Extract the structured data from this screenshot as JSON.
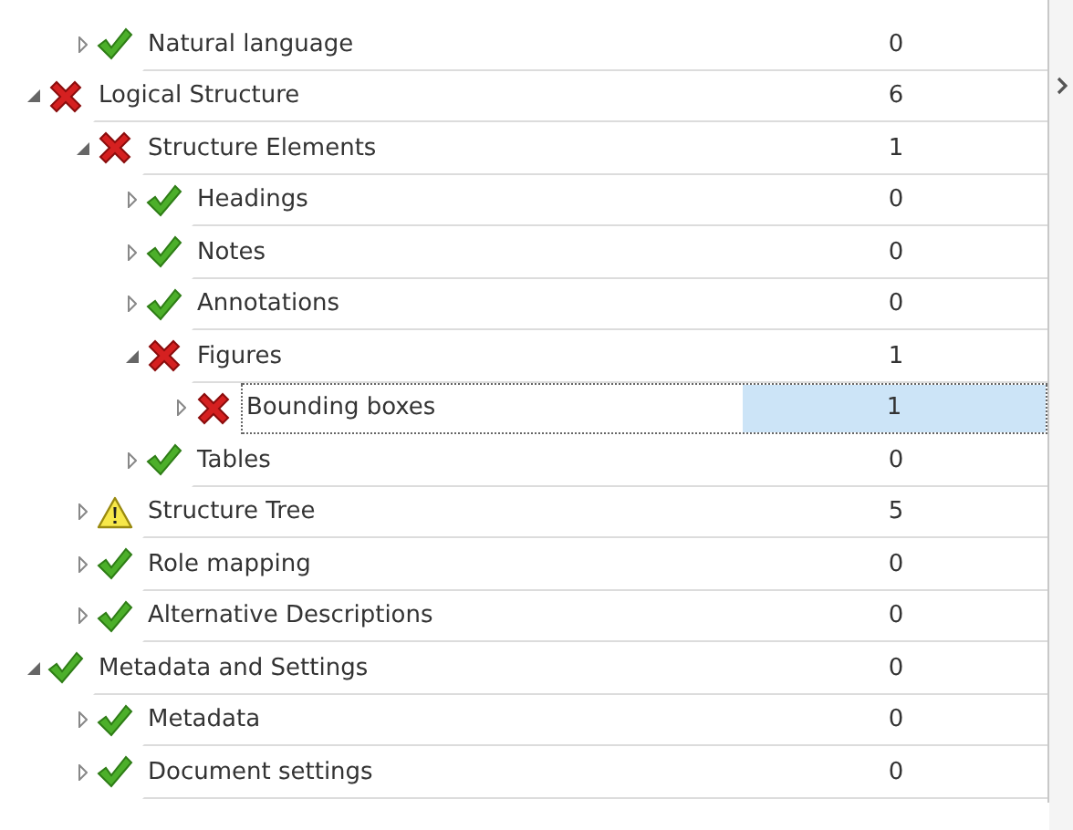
{
  "tree": {
    "continued": [
      {
        "label": "Natural language",
        "count": "0",
        "kind": "pass",
        "expanded": false,
        "selected": false
      }
    ],
    "items": [
      {
        "label": "Logical Structure",
        "count": "6",
        "kind": "fail",
        "expanded": true,
        "selected": false,
        "children": [
          {
            "label": "Structure Elements",
            "count": "1",
            "kind": "fail",
            "expanded": true,
            "selected": false,
            "children": [
              {
                "label": "Headings",
                "count": "0",
                "kind": "pass",
                "expanded": false,
                "selected": false
              },
              {
                "label": "Notes",
                "count": "0",
                "kind": "pass",
                "expanded": false,
                "selected": false
              },
              {
                "label": "Annotations",
                "count": "0",
                "kind": "pass",
                "expanded": false,
                "selected": false
              },
              {
                "label": "Figures",
                "count": "1",
                "kind": "fail",
                "expanded": true,
                "selected": false,
                "children": [
                  {
                    "label": "Bounding boxes",
                    "count": "1",
                    "kind": "fail",
                    "expanded": false,
                    "selected": true
                  }
                ]
              },
              {
                "label": "Tables",
                "count": "0",
                "kind": "pass",
                "expanded": false,
                "selected": false
              }
            ]
          },
          {
            "label": "Structure Tree",
            "count": "5",
            "kind": "warning",
            "expanded": false,
            "selected": false
          },
          {
            "label": "Role mapping",
            "count": "0",
            "kind": "pass",
            "expanded": false,
            "selected": false
          },
          {
            "label": "Alternative Descriptions",
            "count": "0",
            "kind": "pass",
            "expanded": false,
            "selected": false
          }
        ]
      },
      {
        "label": "Metadata and Settings",
        "count": "0",
        "kind": "pass",
        "expanded": true,
        "selected": false,
        "children": [
          {
            "label": "Metadata",
            "count": "0",
            "kind": "pass",
            "expanded": false,
            "selected": false
          },
          {
            "label": "Document settings",
            "count": "0",
            "kind": "pass",
            "expanded": false,
            "selected": false
          }
        ]
      }
    ]
  }
}
